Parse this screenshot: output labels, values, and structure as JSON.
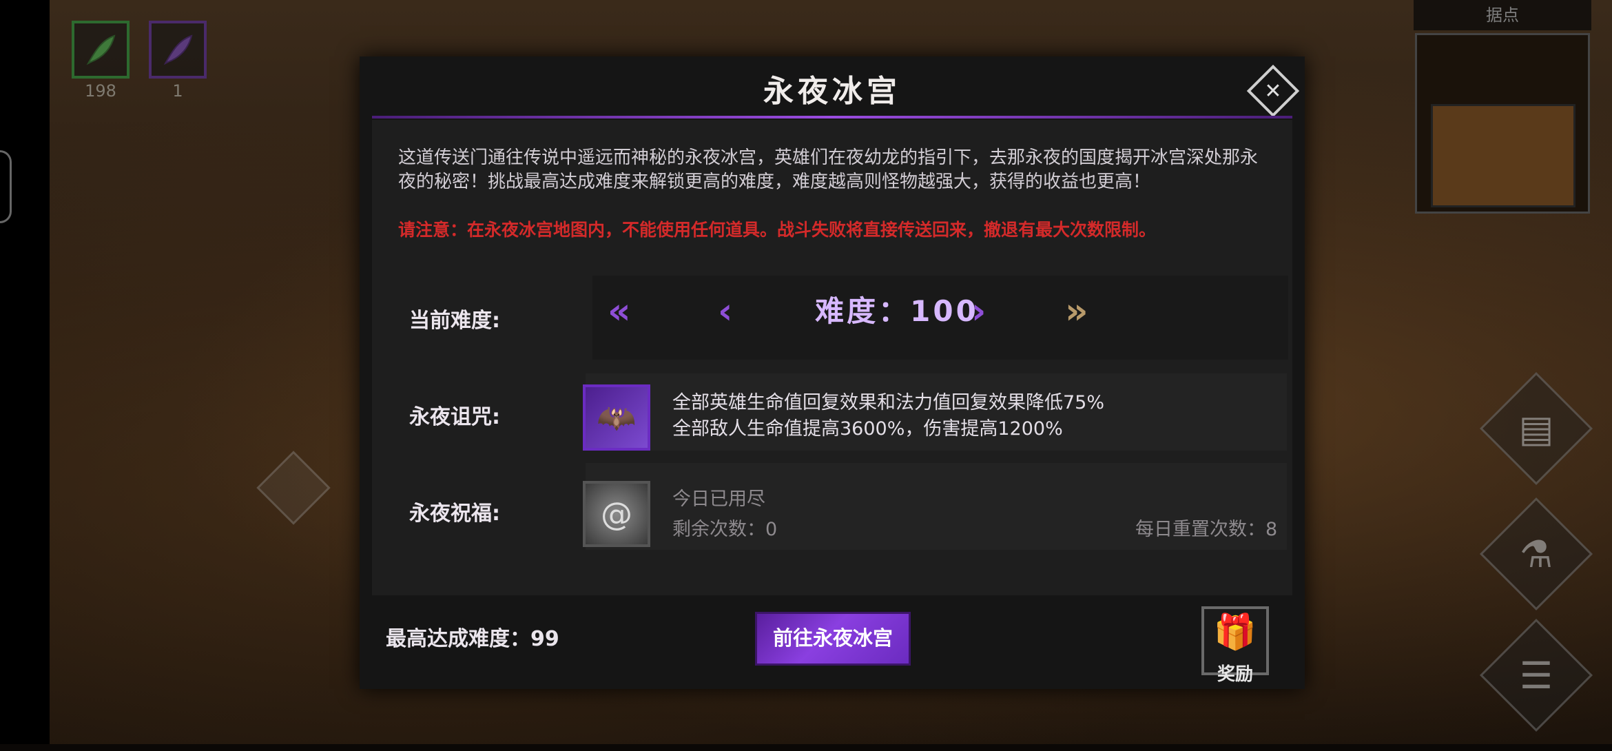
{
  "hud": {
    "resources": [
      {
        "icon": "green-feather-icon",
        "count": "198"
      },
      {
        "icon": "purple-feather-icon",
        "count": "1"
      }
    ],
    "minimap_title": "据点"
  },
  "dialog": {
    "title": "永夜冰宫",
    "description": "这道传送门通往传说中遥远而神秘的永夜冰宫，英雄们在夜幼龙的指引下，去那永夜的国度揭开冰宫深处那永夜的秘密！挑战最高达成难度来解锁更高的难度，难度越高则怪物越强大，获得的收益也更高！",
    "warning": "请注意：在永夜冰宫地图内，不能使用任何道具。战斗失败将直接传送回来，撤退有最大次数限制。",
    "difficulty": {
      "label": "当前难度:",
      "value_text": "难度：100",
      "arrows": {
        "fast_prev": "«",
        "prev": "‹",
        "next": "›",
        "fast_next": "»"
      }
    },
    "curse": {
      "label": "永夜诅咒:",
      "line1": "全部英雄生命值回复效果和法力值回复效果降低75%",
      "line2": "全部敌人生命值提高3600%，伤害提高1200%"
    },
    "blessing": {
      "label": "永夜祝福:",
      "status": "今日已用尽",
      "remaining": "剩余次数：0",
      "daily_reset": "每日重置次数：8"
    },
    "best_difficulty": "最高达成难度：99",
    "go_button": "前往永夜冰宫",
    "reward_label": "奖励"
  },
  "colors": {
    "accent_purple": "#8e4ed6",
    "warning_red": "#d42a2a",
    "gold_arrow": "#b89a6a"
  }
}
